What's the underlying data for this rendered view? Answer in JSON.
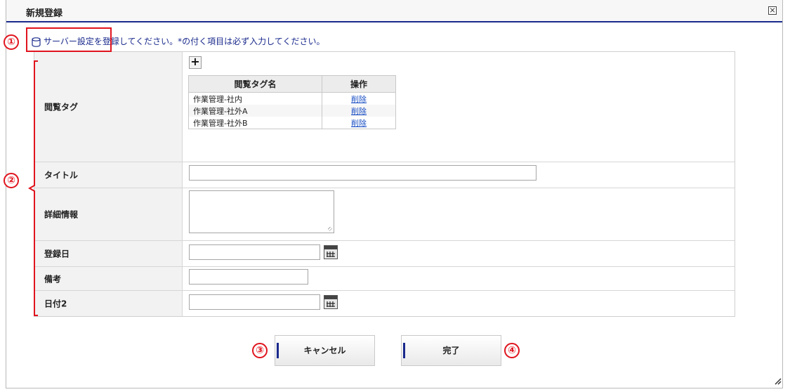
{
  "dialog": {
    "title": "新規登録"
  },
  "instruction": {
    "text": "サーバー設定を登録してください。*の付く項目は必ず入力してください。"
  },
  "form": {
    "rows": [
      {
        "label": "閲覧タグ"
      },
      {
        "label": "タイトル"
      },
      {
        "label": "詳細情報"
      },
      {
        "label": "登録日"
      },
      {
        "label": "備考"
      },
      {
        "label": "日付2"
      }
    ],
    "tags": {
      "add_button": "+",
      "headers": [
        "閲覧タグ名",
        "操作"
      ],
      "items": [
        {
          "name": "作業管理-社内",
          "action": "削除"
        },
        {
          "name": "作業管理-社外A",
          "action": "削除"
        },
        {
          "name": "作業管理-社外B",
          "action": "削除"
        }
      ]
    }
  },
  "buttons": {
    "cancel": "キャンセル",
    "complete": "完了"
  },
  "annotations": [
    "①",
    "②",
    "③",
    "④"
  ],
  "colors": {
    "accent": "#1a2a8c",
    "annotation": "#e0141e",
    "link": "#1a4fc4"
  },
  "icons": [
    "database-icon",
    "close-icon",
    "calendar-icon",
    "plus-icon",
    "resize-grip-icon"
  ]
}
